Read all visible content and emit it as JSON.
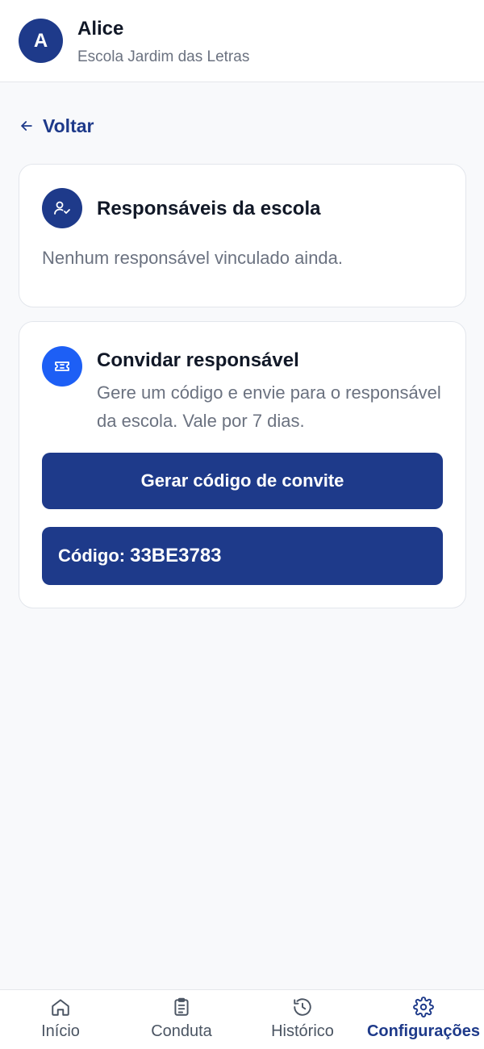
{
  "header": {
    "avatar_letter": "A",
    "user_name": "Alice",
    "school_name": "Escola Jardim das Letras"
  },
  "back": {
    "label": "Voltar"
  },
  "guardians_card": {
    "title": "Responsáveis da escola",
    "empty_text": "Nenhum responsável vinculado ainda.",
    "icon": "user-check-icon"
  },
  "invite_card": {
    "title": "Convidar responsável",
    "description": "Gere um código e envie para o responsável da escola. Vale por 7 dias.",
    "button_label": "Gerar código de convite",
    "code_label": "Código:",
    "code_value": "33BE3783",
    "icon": "ticket-icon"
  },
  "nav": {
    "items": [
      {
        "label": "Início",
        "icon": "home-icon",
        "active": false
      },
      {
        "label": "Conduta",
        "icon": "clipboard-icon",
        "active": false
      },
      {
        "label": "Histórico",
        "icon": "history-icon",
        "active": false
      },
      {
        "label": "Configurações",
        "icon": "gear-icon",
        "active": true
      }
    ]
  },
  "colors": {
    "primary": "#1e3a8a",
    "accent_blue": "#1d5ff5",
    "background": "#f8f9fb",
    "muted_text": "#6b7280"
  }
}
